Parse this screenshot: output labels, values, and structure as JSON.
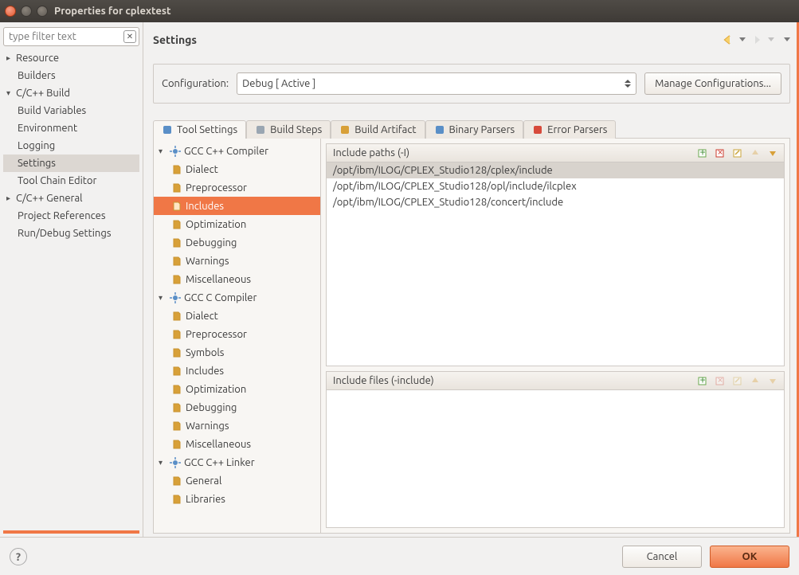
{
  "window": {
    "title": "Properties for cplextest"
  },
  "filter": {
    "placeholder": "type filter text"
  },
  "nav": [
    {
      "label": "Resource",
      "twisty": "▸",
      "indent": 0
    },
    {
      "label": "Builders",
      "twisty": "",
      "indent": 1
    },
    {
      "label": "C/C++ Build",
      "twisty": "▾",
      "indent": 0
    },
    {
      "label": "Build Variables",
      "twisty": "",
      "indent": 1
    },
    {
      "label": "Environment",
      "twisty": "",
      "indent": 1
    },
    {
      "label": "Logging",
      "twisty": "",
      "indent": 1
    },
    {
      "label": "Settings",
      "twisty": "",
      "indent": 1,
      "selected": true
    },
    {
      "label": "Tool Chain Editor",
      "twisty": "",
      "indent": 1
    },
    {
      "label": "C/C++ General",
      "twisty": "▸",
      "indent": 0
    },
    {
      "label": "Project References",
      "twisty": "",
      "indent": 1
    },
    {
      "label": "Run/Debug Settings",
      "twisty": "",
      "indent": 1
    }
  ],
  "page": {
    "title": "Settings"
  },
  "config": {
    "label": "Configuration:",
    "value": "Debug  [ Active ]",
    "manage": "Manage Configurations..."
  },
  "tabs": [
    {
      "label": "Tool Settings",
      "active": true,
      "iconColor": "#5a8fc7"
    },
    {
      "label": "Build Steps",
      "active": false,
      "iconColor": "#9aa6b2"
    },
    {
      "label": "Build Artifact",
      "active": false,
      "iconColor": "#d8a038"
    },
    {
      "label": "Binary Parsers",
      "active": false,
      "iconColor": "#5a8fc7"
    },
    {
      "label": "Error Parsers",
      "active": false,
      "iconColor": "#d74a3b"
    }
  ],
  "toolTree": [
    {
      "label": "GCC C++ Compiler",
      "type": "group",
      "twisty": "▾"
    },
    {
      "label": "Dialect",
      "type": "item"
    },
    {
      "label": "Preprocessor",
      "type": "item"
    },
    {
      "label": "Includes",
      "type": "item",
      "selected": true
    },
    {
      "label": "Optimization",
      "type": "item"
    },
    {
      "label": "Debugging",
      "type": "item"
    },
    {
      "label": "Warnings",
      "type": "item"
    },
    {
      "label": "Miscellaneous",
      "type": "item"
    },
    {
      "label": "GCC C Compiler",
      "type": "group",
      "twisty": "▾"
    },
    {
      "label": "Dialect",
      "type": "item"
    },
    {
      "label": "Preprocessor",
      "type": "item"
    },
    {
      "label": "Symbols",
      "type": "item"
    },
    {
      "label": "Includes",
      "type": "item"
    },
    {
      "label": "Optimization",
      "type": "item"
    },
    {
      "label": "Debugging",
      "type": "item"
    },
    {
      "label": "Warnings",
      "type": "item"
    },
    {
      "label": "Miscellaneous",
      "type": "item"
    },
    {
      "label": "GCC C++ Linker",
      "type": "group",
      "twisty": "▾"
    },
    {
      "label": "General",
      "type": "item"
    },
    {
      "label": "Libraries",
      "type": "item"
    }
  ],
  "sections": {
    "includePaths": {
      "title": "Include paths (-I)",
      "items": [
        "/opt/ibm/ILOG/CPLEX_Studio128/cplex/include",
        "/opt/ibm/ILOG/CPLEX_Studio128/opl/include/ilcplex",
        "/opt/ibm/ILOG/CPLEX_Studio128/concert/include"
      ],
      "selectedIndex": 0
    },
    "includeFiles": {
      "title": "Include files (-include)",
      "items": []
    }
  },
  "buttons": {
    "ok": "OK",
    "cancel": "Cancel"
  }
}
